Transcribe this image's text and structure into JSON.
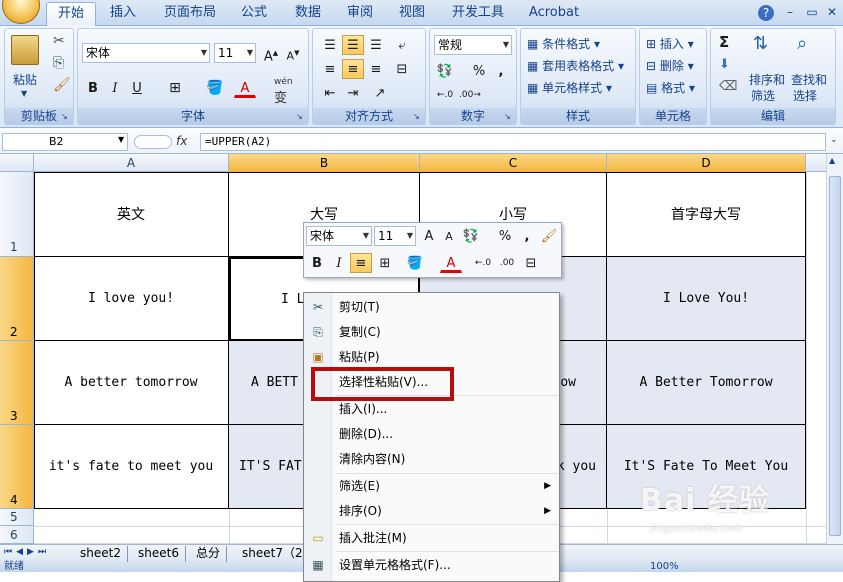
{
  "ribbon_tabs": [
    "开始",
    "插入",
    "页面布局",
    "公式",
    "数据",
    "审阅",
    "视图",
    "开发工具",
    "Acrobat"
  ],
  "window_controls": {
    "help": "?",
    "minimize": "–",
    "restore": "▭",
    "close": "✕"
  },
  "clipboard": {
    "paste": "粘贴",
    "group": "剪贴板"
  },
  "font": {
    "name": "宋体",
    "size": "11",
    "bold": "B",
    "italic": "I",
    "underline": "U",
    "font_color": "A",
    "phonetic": "wén",
    "phonetic2": "变",
    "group": "字体"
  },
  "alignment": {
    "group": "对齐方式"
  },
  "number": {
    "format": "常规",
    "percent": "%",
    "comma": ",",
    "inc": "←.0",
    "dec": ".00→",
    "group": "数字"
  },
  "styles": {
    "conditional": "条件格式",
    "table": "套用表格格式",
    "cell": "单元格样式",
    "group": "样式"
  },
  "cells": {
    "insert": "插入",
    "delete": "删除",
    "format": "格式",
    "group": "单元格"
  },
  "editing": {
    "sum": "Σ",
    "sort_filter": "排序和",
    "sort_filter2": "筛选",
    "find_select": "查找和",
    "find_select2": "选择",
    "group": "编辑"
  },
  "formula_bar": {
    "name_box": "B2",
    "fx": "fx",
    "formula": "=UPPER(A2)"
  },
  "columns": [
    "A",
    "B",
    "C",
    "D"
  ],
  "rows": [
    "1",
    "2",
    "3",
    "4",
    "5",
    "6"
  ],
  "grid": {
    "header": [
      "英文",
      "大写",
      "小写",
      "首字母大写"
    ],
    "row2": [
      "I love you!",
      "I L",
      "",
      "I Love You!"
    ],
    "row3": [
      "A better tomorrow",
      "A BETT",
      "ow",
      "A Better Tomorrow"
    ],
    "row4": [
      "it's fate to meet you",
      "IT'S FAT",
      "k you",
      "It'S Fate To Meet You"
    ]
  },
  "mini_toolbar": {
    "font": "宋体",
    "size": "11",
    "bold": "B",
    "italic": "I",
    "percent": "%",
    "comma": ","
  },
  "context_menu": [
    {
      "label": "剪切(T)",
      "icon": "scissors-icon",
      "glyph": "✂"
    },
    {
      "label": "复制(C)",
      "icon": "copy-icon",
      "glyph": "⎘"
    },
    {
      "label": "粘贴(P)",
      "icon": "paste-icon",
      "glyph": "📋"
    },
    {
      "label": "选择性粘贴(V)...",
      "icon": "",
      "glyph": ""
    },
    {
      "label": "插入(I)...",
      "icon": "",
      "glyph": ""
    },
    {
      "label": "删除(D)...",
      "icon": "",
      "glyph": ""
    },
    {
      "label": "清除内容(N)",
      "icon": "",
      "glyph": ""
    },
    {
      "label": "筛选(E)",
      "icon": "",
      "glyph": "",
      "submenu": "▶"
    },
    {
      "label": "排序(O)",
      "icon": "",
      "glyph": "",
      "submenu": "▶"
    },
    {
      "label": "插入批注(M)",
      "icon": "comment-icon",
      "glyph": "🗨"
    },
    {
      "label": "设置单元格格式(F)...",
      "icon": "format-cells-icon",
      "glyph": "▦"
    }
  ],
  "sheet_tabs": [
    "sheet2",
    "sheet6",
    "总分",
    "sheet7（2"
  ],
  "status": {
    "ready": "就绪",
    "zoom": "100%"
  },
  "watermark": {
    "brand": "Bai 经验",
    "url": "jingyan.baidu.com"
  },
  "colors": {
    "selection_header": "#f4b53d",
    "highlight_box": "#b80d0d",
    "ribbon_text": "#15428b"
  }
}
